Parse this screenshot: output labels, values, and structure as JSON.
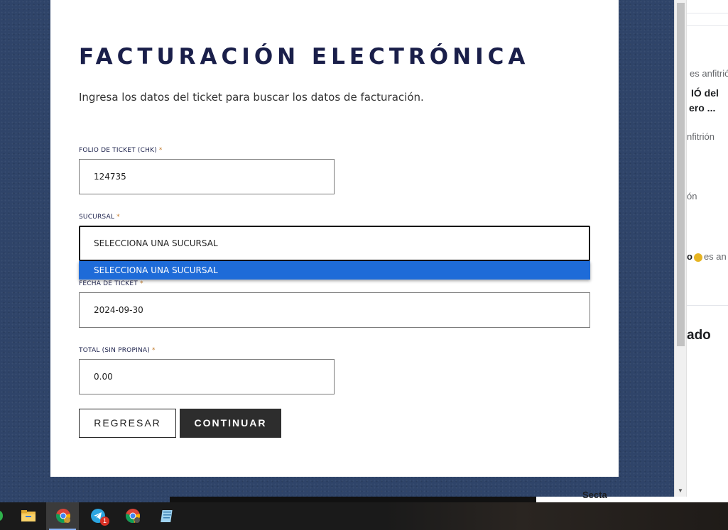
{
  "modal": {
    "title": "FACTURACIÓN ELECTRÓNICA",
    "subtitle": "Ingresa los datos del ticket para buscar los datos de facturación.",
    "fields": {
      "folio": {
        "label": "FOLIO DE TICKET (CHK)",
        "value": "124735"
      },
      "sucursal": {
        "label": "SUCURSAL",
        "value": "SELECCIONA UNA SUCURSAL",
        "options": [
          "SELECCIONA UNA SUCURSAL"
        ]
      },
      "fecha": {
        "label": "FECHA DE TICKET",
        "value": "2024-09-30"
      },
      "total": {
        "label": "TOTAL (SIN PROPINA)",
        "value": "0.00"
      }
    },
    "required_mark": "*",
    "buttons": {
      "back": "REGRESAR",
      "continue": "CONTINUAR"
    }
  },
  "side_panel": {
    "line1": "es anfitrión",
    "line2": "IÓ del",
    "line3": "ero ...",
    "line4": "nfitrión",
    "line5": "ón",
    "line6_bold": "o",
    "line6_rest": "es an",
    "heading": "ado",
    "bottom": "Secta"
  },
  "taskbar": {
    "apps": [
      {
        "name": "file-explorer",
        "icon": "folder-icon"
      },
      {
        "name": "chrome",
        "icon": "chrome-icon",
        "active": true
      },
      {
        "name": "telegram",
        "icon": "telegram-icon",
        "badge": "1"
      },
      {
        "name": "chrome-profile",
        "icon": "chrome-icon"
      },
      {
        "name": "notepad",
        "icon": "notepad-icon"
      }
    ]
  },
  "colors": {
    "title": "#1a1f4a",
    "required": "#c27a2a",
    "dropdown_highlight": "#1e6bd8",
    "continue_button": "#2d2d2d",
    "background": "#2f4469"
  }
}
